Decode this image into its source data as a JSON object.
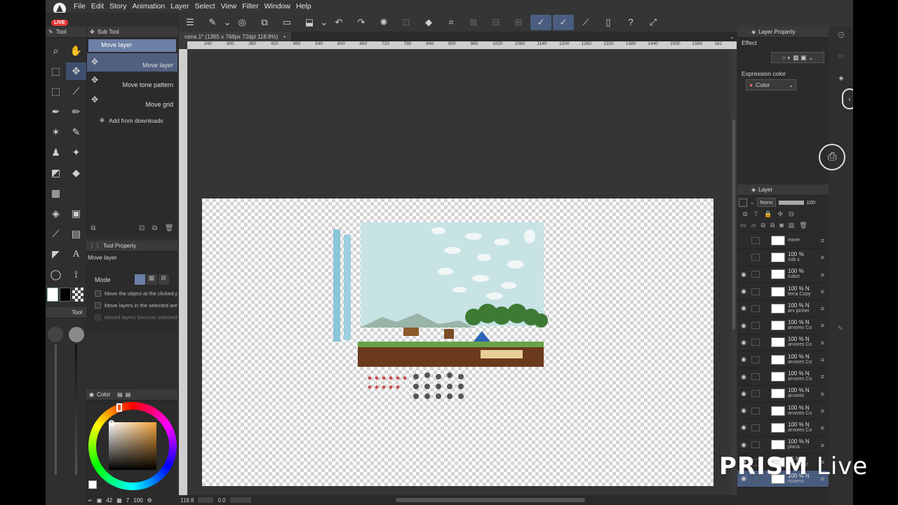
{
  "menu": [
    "File",
    "Edit",
    "Story",
    "Animation",
    "Layer",
    "Select",
    "View",
    "Filter",
    "Window",
    "Help"
  ],
  "live_badge": "LIVE",
  "toolbar_icons": [
    "menu-icon",
    "new-icon",
    "chevron-icon",
    "record-icon",
    "copy-icon",
    "open-icon",
    "save-icon",
    "chevron-icon",
    "undo-icon",
    "redo-icon",
    "spinner-icon",
    "transform-icon",
    "fill-icon",
    "crop-icon",
    "dim1-icon",
    "dim2-icon",
    "dim3-icon",
    "pen-stabilize-icon",
    "pen-correct-icon",
    "pen-icon",
    "device-icon",
    "help-icon",
    "share-icon"
  ],
  "tool_panel": {
    "tab_tool": "Tool",
    "tab_subtool": "Sub Tool"
  },
  "subtools": [
    "Move layer",
    "Move layer",
    "Move tone pattern",
    "Move grid"
  ],
  "add_from_downloads": "Add from downloads",
  "tool_property": {
    "title": "Tool Property",
    "tool_name": "Move layer",
    "mode_label": "Mode",
    "options": [
      "Move the object at the clicked position",
      "Move layers in the selected area",
      "Moved layers become selected"
    ]
  },
  "tool_mini": "Tool",
  "color_panel": {
    "title": "Color",
    "size_value": "42",
    "opacity_value": "7",
    "brush_value": "100",
    "main_color": "#f2a23a"
  },
  "canvas": {
    "tab_title": "cena 1* (1365 x 768px 72dpi 118.8%)",
    "ruler_labels": [
      "240",
      "300",
      "360",
      "420",
      "480",
      "540",
      "600",
      "660",
      "720",
      "780",
      "840",
      "900",
      "960",
      "1020",
      "1080",
      "1140",
      "1200",
      "1260",
      "1320",
      "1380",
      "1440",
      "1500",
      "1560",
      "162"
    ]
  },
  "status": {
    "zoom": "118.8",
    "angle": "0.0"
  },
  "layer_property": {
    "title": "Layer Property",
    "effect_label": "Effect",
    "expression_label": "Expression color",
    "expression_value": "Color"
  },
  "layer_panel": {
    "title": "Layer",
    "blend": "Norm",
    "opacity": "100"
  },
  "layers": [
    {
      "pct": "",
      "name": "miner"
    },
    {
      "pct": "100 %",
      "name": "sub s"
    },
    {
      "pct": "100 %",
      "name": "subst"
    },
    {
      "pct": "100 % N",
      "name": "terra Copy"
    },
    {
      "pct": "100 % N",
      "name": "arv pinhei"
    },
    {
      "pct": "100 % N",
      "name": "arvores Co"
    },
    {
      "pct": "100 % N",
      "name": "arvores Co"
    },
    {
      "pct": "100 % N",
      "name": "arvores Co"
    },
    {
      "pct": "100 % N",
      "name": "arvores Co"
    },
    {
      "pct": "100 % N",
      "name": "arvores"
    },
    {
      "pct": "100 % N",
      "name": "arvores Co"
    },
    {
      "pct": "100 % N",
      "name": "arvores Co"
    },
    {
      "pct": "100 % N",
      "name": "placa"
    },
    {
      "pct": "95 % N",
      "name": "nuvens 2"
    },
    {
      "pct": "100 % N",
      "name": "nuvens"
    }
  ],
  "watermark": {
    "bold": "PRISM",
    "light": "Live"
  }
}
